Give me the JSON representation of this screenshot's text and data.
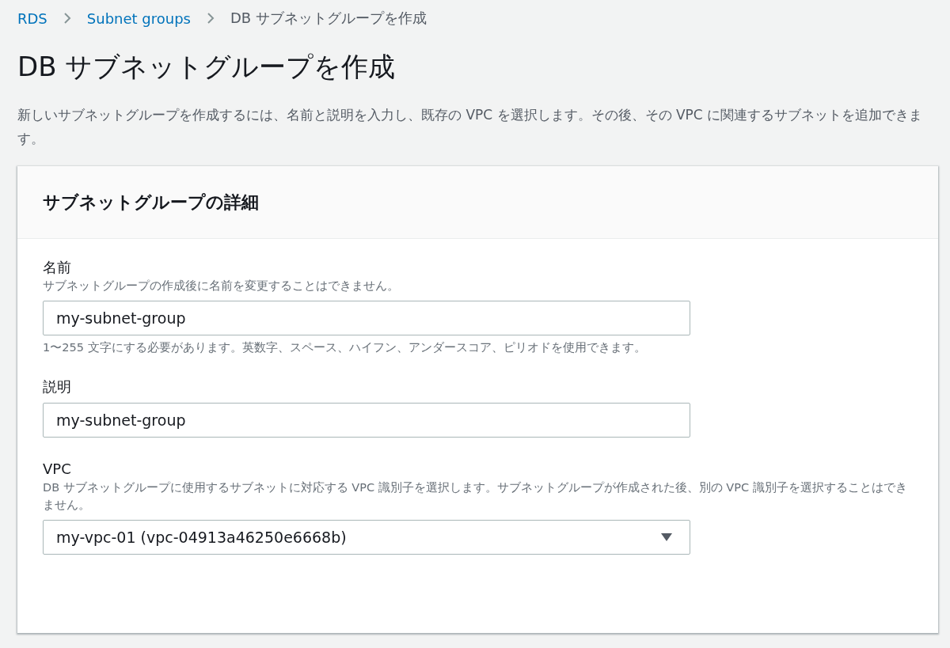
{
  "breadcrumb": [
    {
      "label": "RDS",
      "kind": "link"
    },
    {
      "label": "Subnet groups",
      "kind": "link"
    },
    {
      "label": "DB サブネットグループを作成",
      "kind": "current"
    }
  ],
  "page_title": "DB サブネットグループを作成",
  "description": "新しいサブネットグループを作成するには、名前と説明を入力し、既存の VPC を選択します。その後、その VPC に関連するサブネットを追加できます。",
  "panel": {
    "title": "サブネットグループの詳細",
    "fields": [
      {
        "kind": "text",
        "label": "名前",
        "hint": "サブネットグループの作成後に名前を変更することはできません。",
        "value": "my-subnet-group",
        "constraint": "1〜255 文字にする必要があります。英数字、スペース、ハイフン、アンダースコア、ピリオドを使用できます。"
      },
      {
        "kind": "text",
        "label": "説明",
        "value": "my-subnet-group"
      },
      {
        "kind": "select",
        "label": "VPC",
        "hint": "DB サブネットグループに使用するサブネットに対応する VPC 識別子を選択します。サブネットグループが作成された後、別の VPC 識別子を選択することはできません。",
        "value": "my-vpc-01 (vpc-04913a46250e6668b)"
      }
    ]
  }
}
